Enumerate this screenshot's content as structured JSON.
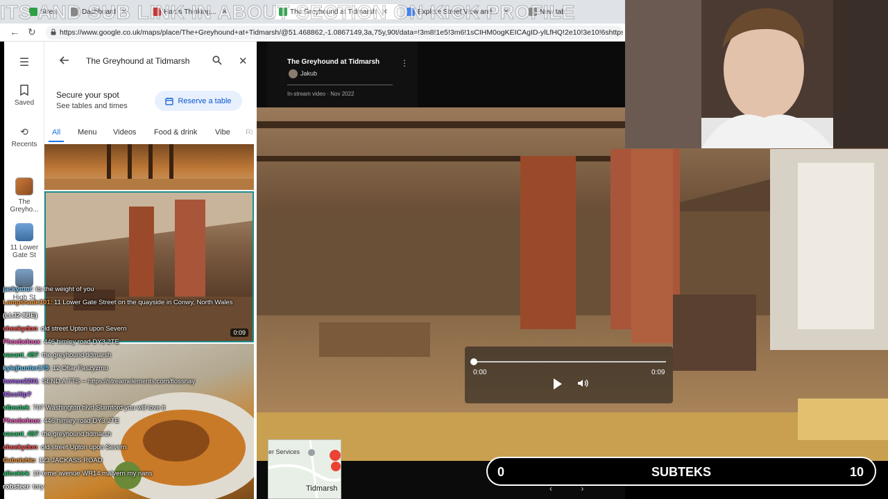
{
  "browser": {
    "tabs": [
      {
        "label": "Strea",
        "color": "#2ea043"
      },
      {
        "label": "Dashboard",
        "color": "#888888"
      },
      {
        "label": "Harris Thinking...",
        "color": "#cc3333"
      },
      {
        "label": "The Greyhound at Tidmarsh",
        "color": "#34a853"
      },
      {
        "label": "Explore Street View and...",
        "color": "#4285f4"
      },
      {
        "label": "New tab",
        "color": "#888888"
      }
    ],
    "banner": "ITS AND SUB LINK IN ABOUT SECTION ON KICK PROFILE",
    "url": "https://www.google.co.uk/maps/place/The+Greyhound+at+Tidmarsh/@51.468862,-1.0867149,3a,75y,90t/data=!3m8!1e5!3m6!1sCIHM0ogKEICAgID-ylLfHQ!2e10!3e10!6shttps:"
  },
  "rail": {
    "saved": "Saved",
    "recents": "Recents",
    "places": [
      {
        "label1": "The",
        "label2": "Greyho..."
      },
      {
        "label1": "11 Lower",
        "label2": "Gate St"
      },
      {
        "label1": "",
        "label2": "High St"
      }
    ]
  },
  "panel": {
    "search_value": "The Greyhound at Tidmarsh",
    "secure_title": "Secure your spot",
    "secure_sub": "See tables and times",
    "reserve_label": "Reserve a table",
    "tabs": [
      "All",
      "Menu",
      "Videos",
      "Food & drink",
      "Vibe",
      "Ri"
    ],
    "video_duration": "0:09"
  },
  "video": {
    "title": "The Greyhound at Tidmarsh",
    "author": "Jakub",
    "meta": "In-stream video · Nov 2022",
    "time_current": "0:00",
    "time_total": "0:09",
    "progress": 0
  },
  "minimap": {
    "label_top": "er Services",
    "label_bottom": "Tidmarsh"
  },
  "chat": [
    {
      "user": "jackytuur",
      "text": ": its the weight of you",
      "color": "#7ec8ff"
    },
    {
      "user": "Lampshade101",
      "text": ": 11 Lower Gate Street on the quayside in Conwy, North Wales",
      "color": "#ff9d3b"
    },
    {
      "user": "(LL32 8BE)",
      "text": "",
      "color": "#ffffff"
    },
    {
      "user": "cheekydon",
      "text": ": old street Upton upon Severn",
      "color": "#ff4d4d"
    },
    {
      "user": "Phoebeloux",
      "text": ": 446 himley road DY3 2TE",
      "color": "#ff66cc"
    },
    {
      "user": "vacant_457",
      "text": ": the greyhound tidmarsh",
      "color": "#2ecc71"
    },
    {
      "user": "kylejhunter179",
      "text": ": 12 Ofiar Faszyzmu",
      "color": "#66ccff"
    },
    {
      "user": "hwnso2201",
      "text": ": SEND A TTS -- https://streamelements.com/flossnay",
      "color": "#b266ff"
    },
    {
      "user": "92cc/tip?",
      "text": "",
      "color": "#b266ff"
    },
    {
      "user": "vibestek",
      "text": ": 707 Washington blvd Stamford you will love it",
      "color": "#2ecc71"
    },
    {
      "user": "Phoebeloux",
      "text": ": 446 himley road DY3 2TE",
      "color": "#ff66cc"
    },
    {
      "user": "vacant_457",
      "text": ": the greyhound tidmarsh",
      "color": "#2ecc71"
    },
    {
      "user": "cheekydon",
      "text": ": old street Upton upon Severn",
      "color": "#ff4d4d"
    },
    {
      "user": "Gaboishio",
      "text": ": 123 JACKASS ROAD",
      "color": "#ff9d3b"
    },
    {
      "user": "alicekirk",
      "text": ": 10 teme avenue WR14 malvern my nans",
      "color": "#2ecc71"
    },
    {
      "user": "robsteer",
      "text": ": tory",
      "color": "#ffffff"
    }
  ],
  "subteks": {
    "left": "0",
    "label": "SUBTEKS",
    "right": "10"
  }
}
